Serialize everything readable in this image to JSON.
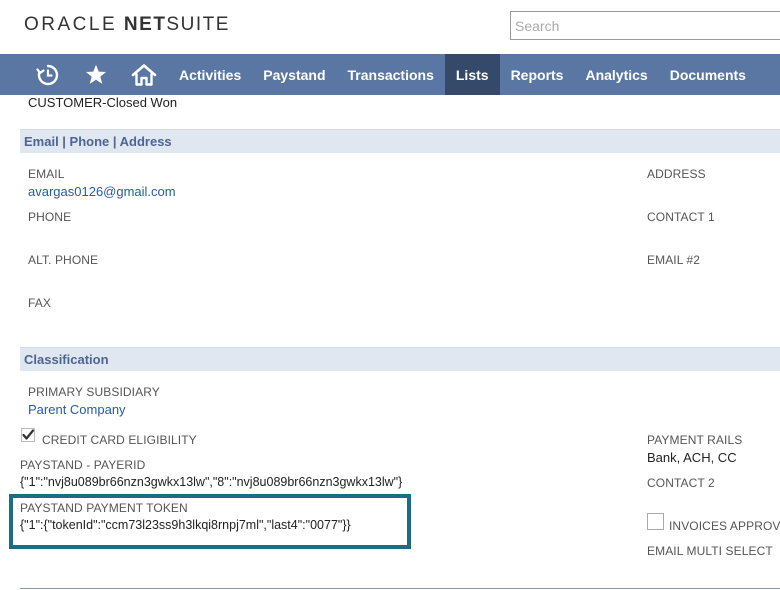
{
  "header": {
    "logo_oracle": "ORACLE",
    "logo_net": "NET",
    "logo_suite": "SUITE",
    "search_placeholder": "Search"
  },
  "nav": {
    "icons": [
      "recent-history-icon",
      "star-icon",
      "home-icon"
    ],
    "items": [
      {
        "label": "Activities"
      },
      {
        "label": "Paystand"
      },
      {
        "label": "Transactions"
      },
      {
        "label": "Lists",
        "active": true
      },
      {
        "label": "Reports"
      },
      {
        "label": "Analytics"
      },
      {
        "label": "Documents"
      }
    ]
  },
  "record": {
    "status_text": "CUSTOMER-Closed Won"
  },
  "sections": {
    "contact": {
      "title": "Email | Phone | Address",
      "email_label": "EMAIL",
      "email_value": "avargas0126@gmail.com",
      "phone_label": "PHONE",
      "alt_phone_label": "ALT. PHONE",
      "fax_label": "FAX",
      "address_label": "ADDRESS",
      "contact1_label": "CONTACT 1",
      "email2_label": "EMAIL #2"
    },
    "classification": {
      "title": "Classification",
      "primary_subsidiary_label": "PRIMARY SUBSIDIARY",
      "primary_subsidiary_value": "Parent Company",
      "credit_card_eligibility_label": "CREDIT CARD ELIGIBILITY",
      "credit_card_eligibility_checked": true,
      "paystand_payerid_label": "PAYSTAND - PAYERID",
      "paystand_payerid_value": "{\"1\":\"nvj8u089br66nzn3gwkx13lw\",\"8\":\"nvj8u089br66nzn3gwkx13lw\"}",
      "paystand_token_label": "PAYSTAND PAYMENT TOKEN",
      "paystand_token_value": "{\"1\":{\"tokenId\":\"ccm73l23ss9h3lkqi8rnpj7ml\",\"last4\":\"0077\"}}",
      "payment_rails_label": "PAYMENT RAILS",
      "payment_rails_value": "Bank, ACH, CC",
      "contact2_label": "CONTACT 2",
      "invoices_approved_label": "INVOICES APPROVED",
      "invoices_approved_checked": false,
      "email_multi_select_label": "EMAIL MULTI SELECT"
    }
  },
  "colors": {
    "nav_bg": "#5a77a3",
    "nav_active_bg": "#35496b",
    "section_header_bg": "#e1e7f0",
    "link": "#255ba8",
    "highlight": "#1b6d86"
  }
}
